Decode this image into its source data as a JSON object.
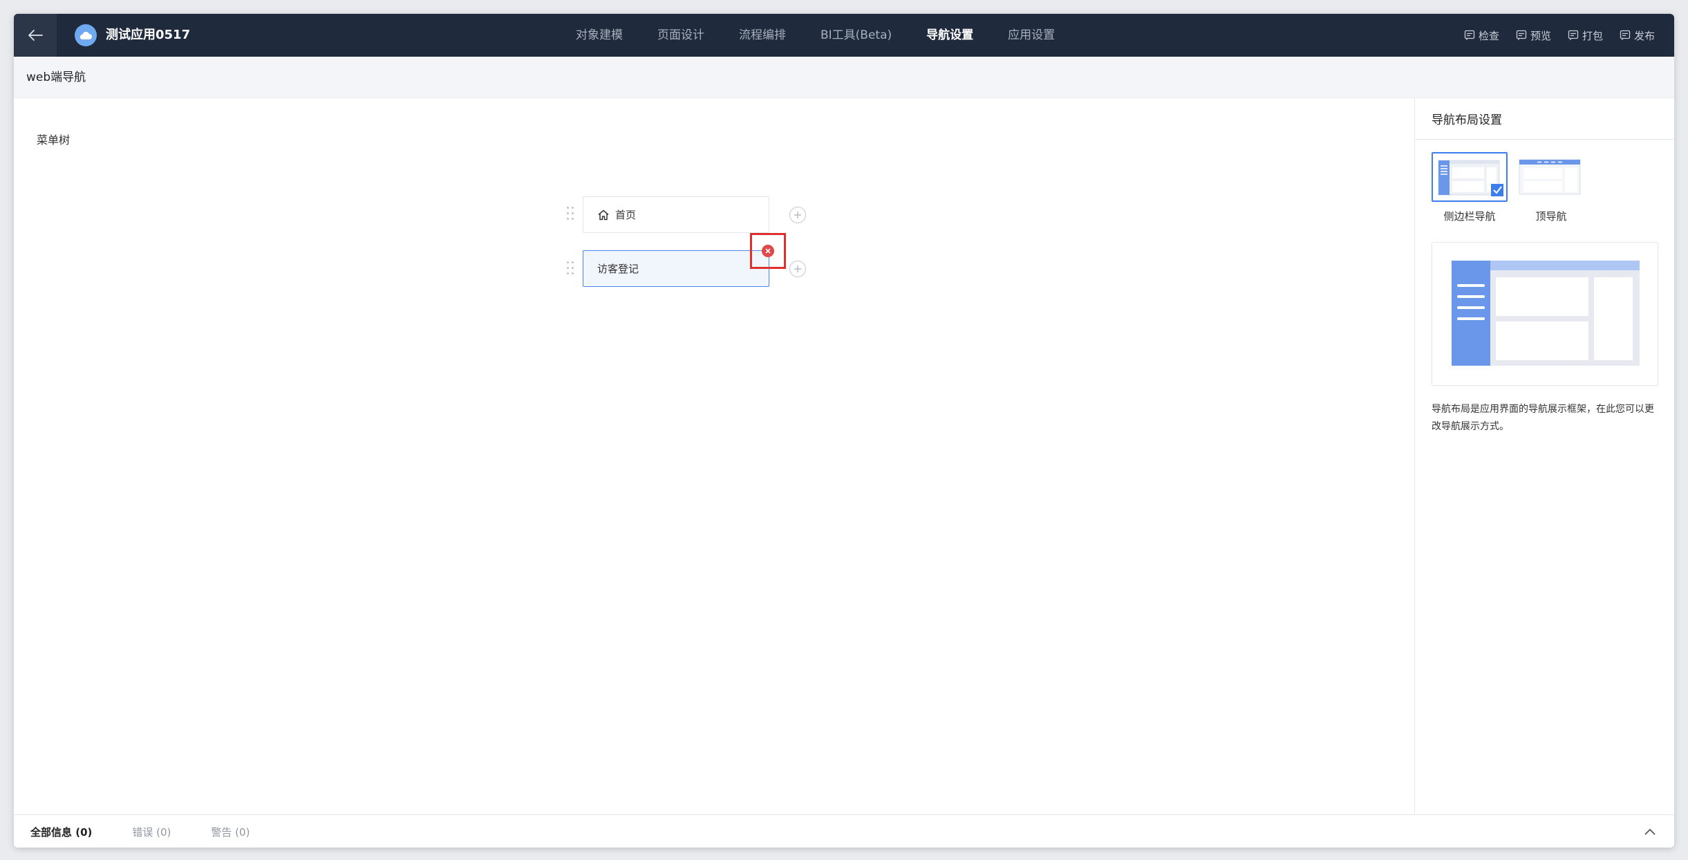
{
  "header": {
    "app_title": "测试应用0517",
    "tabs": [
      "对象建模",
      "页面设计",
      "流程编排",
      "BI工具(Beta)",
      "导航设置",
      "应用设置"
    ],
    "active_tab": "导航设置",
    "actions": [
      "检查",
      "预览",
      "打包",
      "发布"
    ]
  },
  "subheader": {
    "title": "web端导航"
  },
  "canvas": {
    "title": "菜单树",
    "nodes": [
      {
        "label": "首页",
        "icon": "home-icon"
      },
      {
        "label": "访客登记",
        "selected": true
      }
    ]
  },
  "right_panel": {
    "title": "导航布局设置",
    "options": [
      {
        "label": "侧边栏导航",
        "selected": true
      },
      {
        "label": "顶导航",
        "selected": false
      }
    ],
    "description": "导航布局是应用界面的导航展示框架，在此您可以更改导航展示方式。"
  },
  "bottom": {
    "tabs": [
      "全部信息 (0)",
      "错误 (0)",
      "警告 (0)"
    ],
    "active_tab": "全部信息 (0)"
  },
  "colors": {
    "topbar": "#1f2a3c",
    "accent": "#3d7eef",
    "delete": "#e04949",
    "highlight": "#e0302e"
  }
}
